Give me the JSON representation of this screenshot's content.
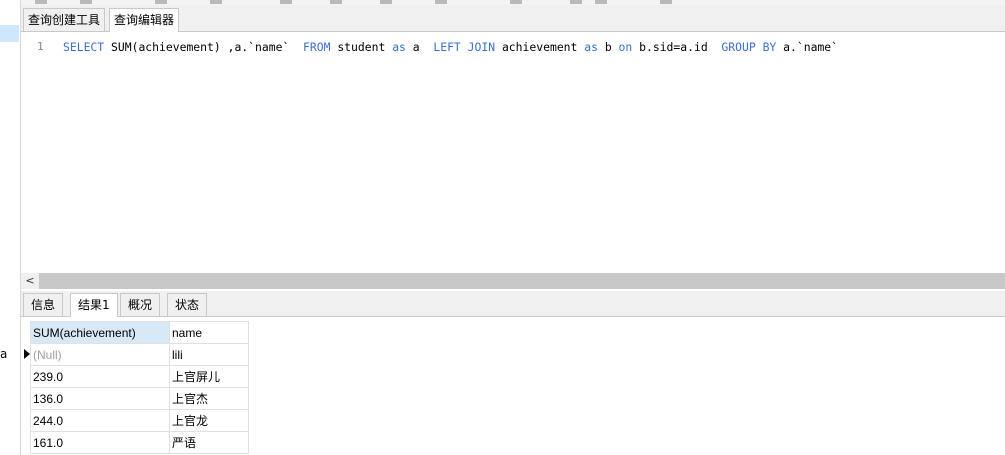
{
  "editor_tabs": [
    "查询创建工具",
    "查询编辑器"
  ],
  "editor": {
    "line_number": "1",
    "tokens": [
      {
        "t": "SELECT",
        "k": true
      },
      {
        "t": " SUM(achievement) ,a.`name`  ",
        "k": false
      },
      {
        "t": "FROM",
        "k": true
      },
      {
        "t": " student ",
        "k": false
      },
      {
        "t": "as",
        "k": true
      },
      {
        "t": " a  ",
        "k": false
      },
      {
        "t": "LEFT JOIN",
        "k": true
      },
      {
        "t": " achievement ",
        "k": false
      },
      {
        "t": "as",
        "k": true
      },
      {
        "t": " b ",
        "k": false
      },
      {
        "t": "on",
        "k": true
      },
      {
        "t": " b.sid=a.id  ",
        "k": false
      },
      {
        "t": "GROUP BY",
        "k": true
      },
      {
        "t": " a.`name`",
        "k": false
      }
    ]
  },
  "scroll_left_glyph": "<",
  "left_truncated": "a",
  "result_tabs": [
    "信息",
    "结果1",
    "概况",
    "状态"
  ],
  "result_active": 1,
  "table": {
    "columns": [
      "SUM(achievement)",
      "name"
    ],
    "rows": [
      [
        "(Null)",
        "lili"
      ],
      [
        "239.0",
        "上官屏儿"
      ],
      [
        "136.0",
        "上官杰"
      ],
      [
        "244.0",
        "上官龙"
      ],
      [
        "161.0",
        "严语"
      ]
    ]
  },
  "colors": {
    "keyword": "#3a6fd1",
    "header_highlight": "#d7e8f7",
    "null_text": "#a0a0a0"
  }
}
